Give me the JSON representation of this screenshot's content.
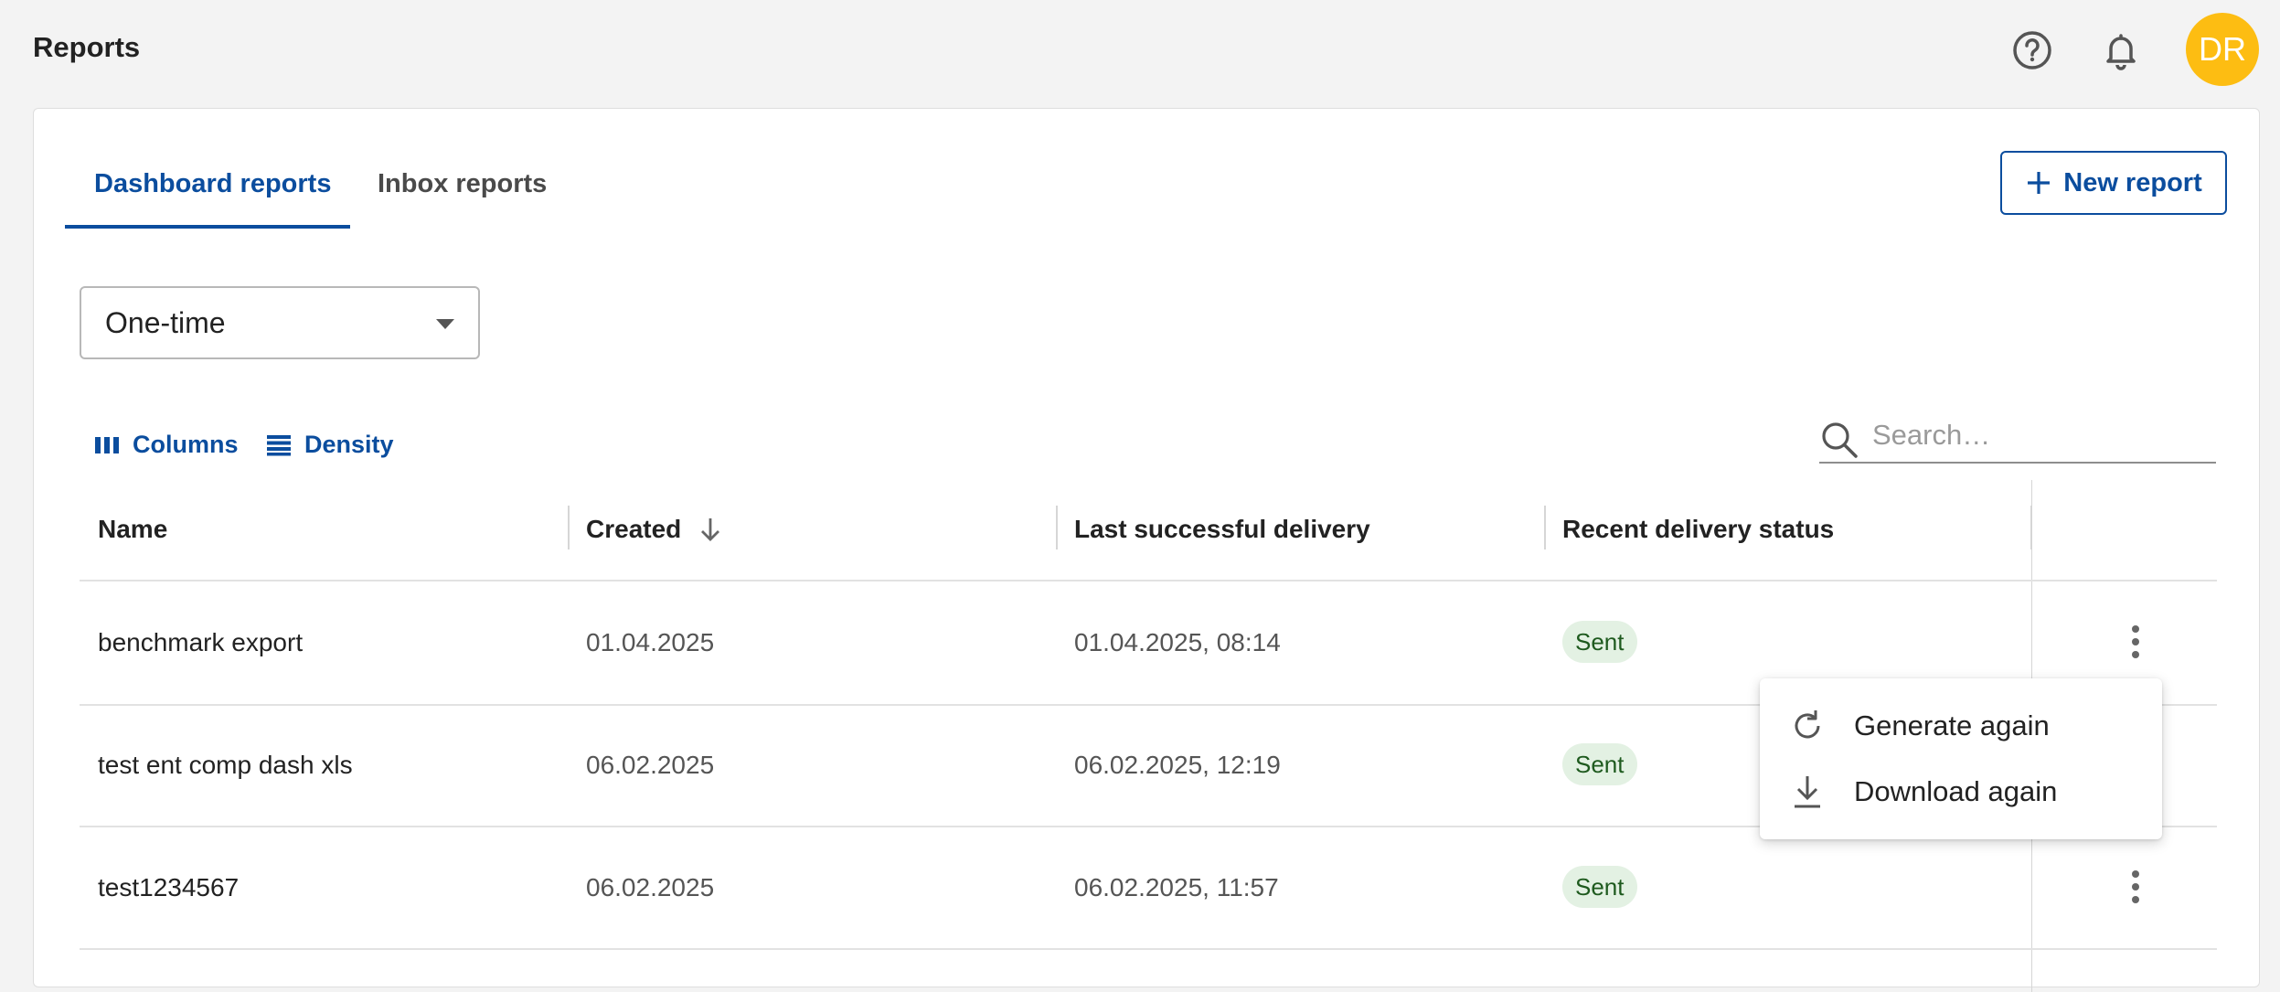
{
  "header": {
    "title": "Reports",
    "avatar_initials": "DR",
    "avatar_color": "#fdbd12"
  },
  "tabs": [
    {
      "label": "Dashboard reports",
      "active": true
    },
    {
      "label": "Inbox reports",
      "active": false
    }
  ],
  "new_report_label": "New report",
  "filter": {
    "selected": "One-time"
  },
  "toolbar": {
    "columns_label": "Columns",
    "density_label": "Density"
  },
  "search": {
    "placeholder": "Search…"
  },
  "table": {
    "columns": [
      "Name",
      "Created",
      "Last successful delivery",
      "Recent delivery status"
    ],
    "rows": [
      {
        "name": "benchmark export",
        "created": "01.04.2025",
        "last_delivery": "01.04.2025, 08:14",
        "status": "Sent"
      },
      {
        "name": "test ent comp dash xls",
        "created": "06.02.2025",
        "last_delivery": "06.02.2025, 12:19",
        "status": "Sent"
      },
      {
        "name": "test1234567",
        "created": "06.02.2025",
        "last_delivery": "06.02.2025, 11:57",
        "status": "Sent"
      }
    ]
  },
  "context_menu": {
    "items": [
      {
        "label": "Generate again",
        "icon": "refresh-icon"
      },
      {
        "label": "Download again",
        "icon": "download-icon"
      }
    ]
  },
  "colors": {
    "accent": "#0b4d9e",
    "status_bg": "#e3f1e3",
    "status_text": "#1e5a1e"
  }
}
